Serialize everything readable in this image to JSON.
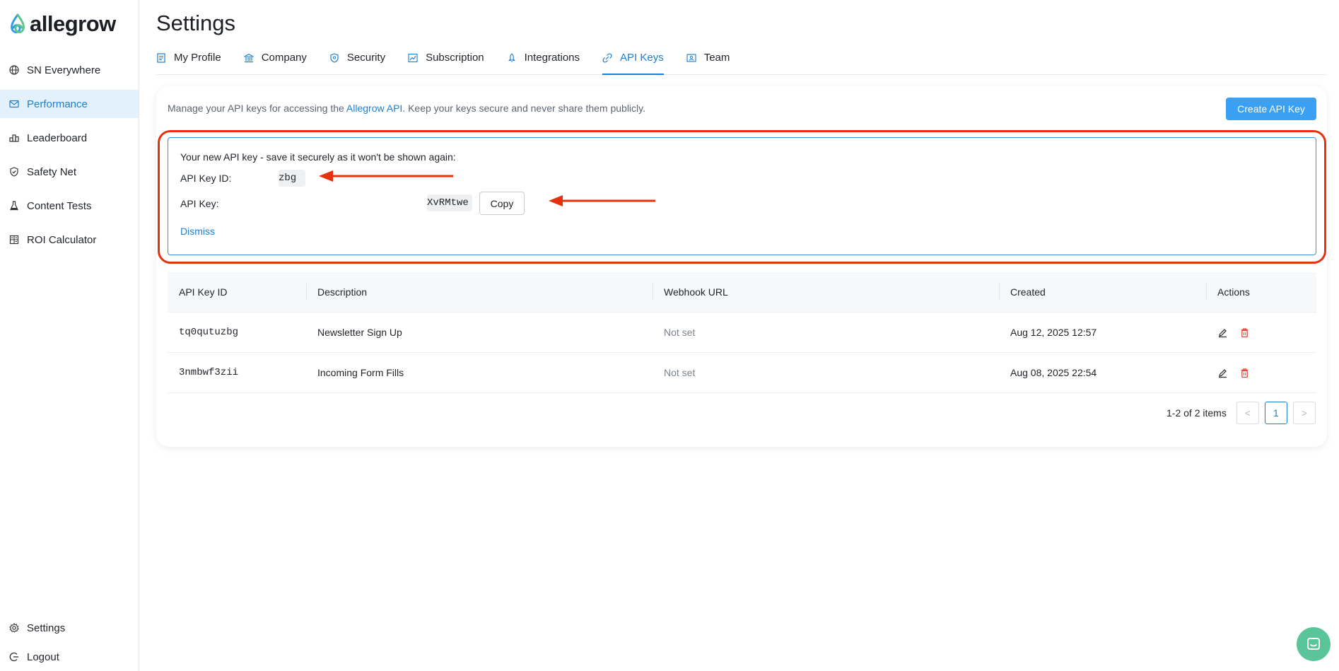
{
  "brand": {
    "name": "allegrow"
  },
  "sidebar": {
    "items": [
      {
        "label": "SN Everywhere",
        "icon": "globe-icon"
      },
      {
        "label": "Performance",
        "icon": "mail-icon",
        "active": true
      },
      {
        "label": "Leaderboard",
        "icon": "podium-icon"
      },
      {
        "label": "Safety Net",
        "icon": "shield-check-icon"
      },
      {
        "label": "Content Tests",
        "icon": "flask-icon"
      },
      {
        "label": "ROI Calculator",
        "icon": "calculator-icon"
      }
    ],
    "bottom": [
      {
        "label": "Settings",
        "icon": "gear-icon"
      },
      {
        "label": "Logout",
        "icon": "logout-icon"
      }
    ]
  },
  "page": {
    "title": "Settings"
  },
  "tabs": [
    {
      "label": "My Profile",
      "icon": "profile-icon"
    },
    {
      "label": "Company",
      "icon": "building-icon"
    },
    {
      "label": "Security",
      "icon": "shield-icon"
    },
    {
      "label": "Subscription",
      "icon": "chart-icon"
    },
    {
      "label": "Integrations",
      "icon": "rocket-icon"
    },
    {
      "label": "API Keys",
      "icon": "key-link-icon",
      "active": true
    },
    {
      "label": "Team",
      "icon": "team-icon"
    }
  ],
  "api": {
    "intro_before": "Manage your API keys for accessing the ",
    "intro_link": "Allegrow API",
    "intro_after": ". Keep your keys secure and never share them publicly.",
    "create_label": "Create API Key",
    "new_key": {
      "title": "Your new API key - save it securely as it won't be shown again:",
      "id_label": "API Key ID:",
      "id_value": "zbg",
      "key_label": "API Key:",
      "key_value": "XvRMtwe",
      "copy_label": "Copy",
      "dismiss_label": "Dismiss"
    },
    "table": {
      "columns": [
        "API Key ID",
        "Description",
        "Webhook URL",
        "Created",
        "Actions"
      ],
      "rows": [
        {
          "id": "tq0qutuzbg",
          "description": "Newsletter Sign Up",
          "webhook": "Not set",
          "created": "Aug 12, 2025 12:57"
        },
        {
          "id": "3nmbwf3zii",
          "description": "Incoming Form Fills",
          "webhook": "Not set",
          "created": "Aug 08, 2025 22:54"
        }
      ]
    },
    "pagination": {
      "info": "1-2 of 2 items",
      "prev": "<",
      "current": "1",
      "next": ">"
    }
  },
  "colors": {
    "accent": "#1d7fd0",
    "primary_button": "#3aa0f3",
    "highlight": "#e5310e",
    "chat": "#5bc59a"
  }
}
